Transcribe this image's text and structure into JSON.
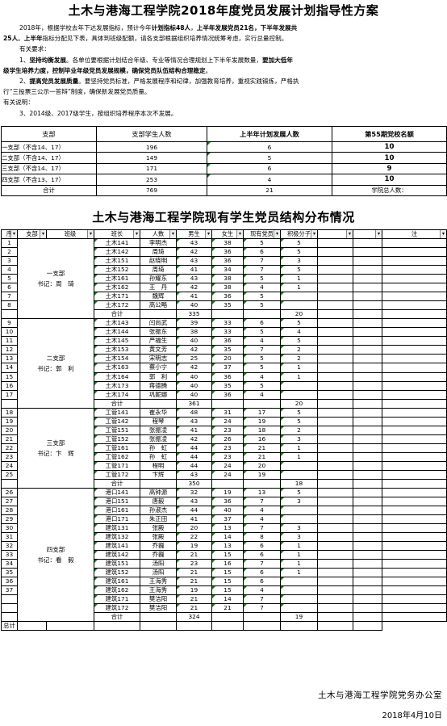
{
  "title": "土木与港海工程学院2018年度党员发展计划指导性方案",
  "intro": {
    "p1": [
      {
        "t": "2018年，根据学校去年下达发展指标，预计今年",
        "b": false
      },
      {
        "t": "计划指标48人",
        "b": true
      },
      {
        "t": "，",
        "b": false
      },
      {
        "t": "上半年发展党员21名",
        "b": true
      },
      {
        "t": "，下半年发展共",
        "b": true
      }
    ],
    "p1b": [
      {
        "t": "25人",
        "b": true
      },
      {
        "t": "。",
        "b": false
      },
      {
        "t": "上半年",
        "b": true
      },
      {
        "t": "指标分配见下表，具体到班级配额，请各支部根据组织培养情况统筹考虑，实行总量控制。",
        "b": false
      }
    ],
    "p2": "有关要求：",
    "p3": [
      {
        "t": "1、",
        "b": false
      },
      {
        "t": "坚持均衡发展",
        "b": true
      },
      {
        "t": "。各单位要根据计划结合年级、专业等情况合理规划上下半年发展数量，",
        "b": false
      },
      {
        "t": "要加大低年",
        "b": true
      }
    ],
    "p3b": [
      {
        "t": "级学生培养力度，控制毕业年级党员发展规模，确保党员队伍结构合理稳定",
        "b": true
      },
      {
        "t": "。",
        "b": false
      }
    ],
    "p4": [
      {
        "t": "2、",
        "b": false
      },
      {
        "t": "提高党员发展质量",
        "b": true
      },
      {
        "t": "。要坚持党员标准，严格发展程序和纪律，加强教育培养，重视实践锻炼，严格执",
        "b": false
      }
    ],
    "p4b": "行“三投票三公示一答辩”制度，确保新发展党员质量。",
    "p5": "有关说明：",
    "p6": "3、2014级、2017级学生，按组织培养程序本次不发展。"
  },
  "plan_table": {
    "headers": [
      "支部",
      "支部学生人数",
      "上半年计划发展人数",
      "第55期党校名额"
    ],
    "rows": [
      {
        "branch": "一支部（不含14、17）",
        "students": "196",
        "plan": "6",
        "quota": "10"
      },
      {
        "branch": "二支部（不含14、17）",
        "students": "149",
        "plan": "5",
        "quota": "10"
      },
      {
        "branch": "三支部（不含14、17）",
        "students": "171",
        "plan": "6",
        "quota": "9"
      },
      {
        "branch": "四支部（不含13、17）",
        "students": "253",
        "plan": "4",
        "quota": "10"
      }
    ],
    "total": {
      "label": "合计",
      "students": "769",
      "plan": "21",
      "note": "学院总人数："
    }
  },
  "title2": "土木与港海工程学院现有学生党员结构分布情况",
  "dist_table": {
    "headers": [
      "序",
      "支部",
      "班级",
      "班长",
      "人数",
      "男生",
      "女生",
      "现有党员",
      "积极分子",
      "",
      "",
      "注"
    ],
    "groups": [
      {
        "branch_name": "一支部",
        "secretary": "书记：周　琦",
        "start": 1,
        "rows": [
          {
            "seq": "1",
            "cls": "土木141",
            "leader": "李明杰",
            "n": "43",
            "m": "38",
            "f": "5",
            "p": "5"
          },
          {
            "seq": "2",
            "cls": "土木142",
            "leader": "周琦",
            "n": "42",
            "m": "36",
            "f": "6",
            "p": "5"
          },
          {
            "seq": "3",
            "cls": "土木151",
            "leader": "赵晓明",
            "n": "43",
            "m": "36",
            "f": "7",
            "p": "3"
          },
          {
            "seq": "4",
            "cls": "土木152",
            "leader": "周琦",
            "n": "41",
            "m": "34",
            "f": "7",
            "p": "5"
          },
          {
            "seq": "5",
            "cls": "土木161",
            "leader": "孙耀东",
            "n": "43",
            "m": "38",
            "f": "5",
            "p": "1"
          },
          {
            "seq": "6",
            "cls": "土木162",
            "leader": "王　丹",
            "n": "42",
            "m": "38",
            "f": "4",
            "p": "1"
          },
          {
            "seq": "7",
            "cls": "土木171",
            "leader": "魏辉",
            "n": "41",
            "m": "36",
            "f": "5",
            "p": ""
          },
          {
            "seq": "8",
            "cls": "土木172",
            "leader": "高公略",
            "n": "40",
            "m": "35",
            "f": "5",
            "p": ""
          }
        ],
        "total": {
          "n": "335",
          "p": "20"
        }
      },
      {
        "branch_name": "二支部",
        "secretary": "书记：郭　利",
        "start": 9,
        "rows": [
          {
            "seq": "9",
            "cls": "土木143",
            "leader": "闫尚武",
            "n": "39",
            "m": "33",
            "f": "6",
            "p": "5"
          },
          {
            "seq": "10",
            "cls": "土木144",
            "leader": "张振东",
            "n": "38",
            "m": "33",
            "f": "5",
            "p": "4"
          },
          {
            "seq": "11",
            "cls": "土木145",
            "leader": "严福生",
            "n": "40",
            "m": "36",
            "f": "4",
            "p": "5"
          },
          {
            "seq": "12",
            "cls": "土木153",
            "leader": "黄文芳",
            "n": "42",
            "m": "35",
            "f": "7",
            "p": "2"
          },
          {
            "seq": "13",
            "cls": "土木154",
            "leader": "宋明志",
            "n": "25",
            "m": "20",
            "f": "5",
            "p": "2"
          },
          {
            "seq": "14",
            "cls": "土木163",
            "leader": "蔡小宁",
            "n": "42",
            "m": "37",
            "f": "5",
            "p": "1"
          },
          {
            "seq": "15",
            "cls": "土木164",
            "leader": "郭　利",
            "n": "40",
            "m": "36",
            "f": "4",
            "p": "1"
          },
          {
            "seq": "16",
            "cls": "土木173",
            "leader": "蒋德腾",
            "n": "40",
            "m": "35",
            "f": "5",
            "p": ""
          },
          {
            "seq": "17",
            "cls": "土木174",
            "leader": "巩妮娜",
            "n": "40",
            "m": "36",
            "f": "4",
            "p": ""
          }
        ],
        "total": {
          "n": "361",
          "p": "20"
        }
      },
      {
        "branch_name": "三支部",
        "secretary": "书记：卞　辉",
        "start": 18,
        "rows": [
          {
            "seq": "18",
            "cls": "工管141",
            "leader": "崔永华",
            "n": "48",
            "m": "31",
            "f": "17",
            "p": "5"
          },
          {
            "seq": "19",
            "cls": "工管142",
            "leader": "程琴",
            "n": "43",
            "m": "24",
            "f": "19",
            "p": "5"
          },
          {
            "seq": "20",
            "cls": "工管151",
            "leader": "张振凌",
            "n": "41",
            "m": "23",
            "f": "18",
            "p": "2"
          },
          {
            "seq": "21",
            "cls": "工管152",
            "leader": "张振凌",
            "n": "42",
            "m": "26",
            "f": "16",
            "p": "3"
          },
          {
            "seq": "22",
            "cls": "工管161",
            "leader": "孙　虹",
            "n": "44",
            "m": "23",
            "f": "21",
            "p": "1"
          },
          {
            "seq": "23",
            "cls": "工管162",
            "leader": "孙　虹",
            "n": "44",
            "m": "23",
            "f": "21",
            "p": "1"
          },
          {
            "seq": "24",
            "cls": "工管171",
            "leader": "程明",
            "n": "44",
            "m": "24",
            "f": "20",
            "p": ""
          },
          {
            "seq": "25",
            "cls": "工管172",
            "leader": "卞辉",
            "n": "43",
            "m": "24",
            "f": "19",
            "p": ""
          }
        ],
        "total": {
          "n": "350",
          "p": "18"
        }
      },
      {
        "branch_name": "四支部",
        "secretary": "书记：看　毅",
        "start": 26,
        "rows": [
          {
            "seq": "26",
            "cls": "港口141",
            "leader": "高钟源",
            "n": "32",
            "m": "19",
            "f": "13",
            "p": "5"
          },
          {
            "seq": "27",
            "cls": "港口151",
            "leader": "唐毅",
            "n": "43",
            "m": "36",
            "f": "7",
            "p": "3"
          },
          {
            "seq": "28",
            "cls": "港口161",
            "leader": "孙淑杰",
            "n": "44",
            "m": "40",
            "f": "4",
            "p": ""
          },
          {
            "seq": "29",
            "cls": "港口171",
            "leader": "朱正田",
            "n": "41",
            "m": "37",
            "f": "4",
            "p": ""
          },
          {
            "seq": "30",
            "cls": "建筑131",
            "leader": "张殿",
            "n": "20",
            "m": "13",
            "f": "7",
            "p": "3"
          },
          {
            "seq": "31",
            "cls": "建筑132",
            "leader": "张殿",
            "n": "22",
            "m": "14",
            "f": "8",
            "p": "3"
          },
          {
            "seq": "32",
            "cls": "建筑141",
            "leader": "乔巍",
            "n": "19",
            "m": "13",
            "f": "6",
            "p": "1"
          },
          {
            "seq": "33",
            "cls": "建筑142",
            "leader": "乔巍",
            "n": "21",
            "m": "15",
            "f": "6",
            "p": "1"
          },
          {
            "seq": "34",
            "cls": "建筑151",
            "leader": "汤阳",
            "n": "23",
            "m": "16",
            "f": "7",
            "p": "1"
          },
          {
            "seq": "35",
            "cls": "建筑152",
            "leader": "汤阳",
            "n": "21",
            "m": "15",
            "f": "6",
            "p": "1"
          },
          {
            "seq": "36",
            "cls": "建筑161",
            "leader": "王海秀",
            "n": "21",
            "m": "15",
            "f": "6",
            "p": ""
          },
          {
            "seq": "37",
            "cls": "建筑162",
            "leader": "王海秀",
            "n": "19",
            "m": "15",
            "f": "4",
            "p": ""
          },
          {
            "seq": "",
            "cls": "建筑171",
            "leader": "樊洁阳",
            "n": "21",
            "m": "14",
            "f": "7",
            "p": ""
          },
          {
            "seq": "",
            "cls": "建筑172",
            "leader": "樊洁阳",
            "n": "21",
            "m": "21",
            "f": "7",
            "p": ""
          }
        ],
        "total": {
          "n": "324",
          "p": "19"
        }
      }
    ],
    "total_label": "合计",
    "grand_total_label": "总计"
  },
  "footer": {
    "org": "土木与港海工程学院党务办公室",
    "date": "2018年4月10日"
  }
}
